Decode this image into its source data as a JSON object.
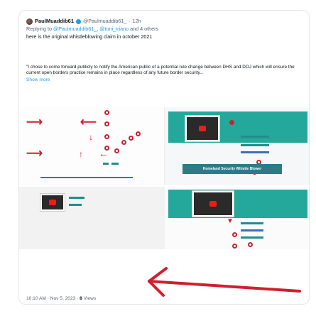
{
  "tweet": {
    "author_name": "PaulMuaddib61",
    "author_handle": "@Paulmuaddib61_",
    "separator": "·",
    "time": "12h",
    "replying_prefix": "Replying to",
    "replying_to_1": "@Paulmuaddib61_",
    "replying_to_2": "@toni_triano",
    "replying_suffix": "and 4 others",
    "text": "here is the original whistleblowing claim in october 2021",
    "quote_text": "\"I chose to come forward publicly to notify the American public of a potential rule change between DHS and DOJ which will ensure the current open borders practice remains in place regardless of any future border security...",
    "show_more": "Show more",
    "banner_text": "Homeland Security Whistle Blower",
    "footer_time": "10:10 AM · Nov 5, 2023 ·",
    "footer_views_count": "8",
    "footer_views_label": "Views"
  },
  "colors": {
    "accent": "#1d9bf0",
    "annotation_red": "#d01f2f",
    "teal": "#25a89c"
  },
  "icons": [
    "verified-badge-icon",
    "red-arrow-icon",
    "red-circle-icon",
    "play-icon"
  ]
}
